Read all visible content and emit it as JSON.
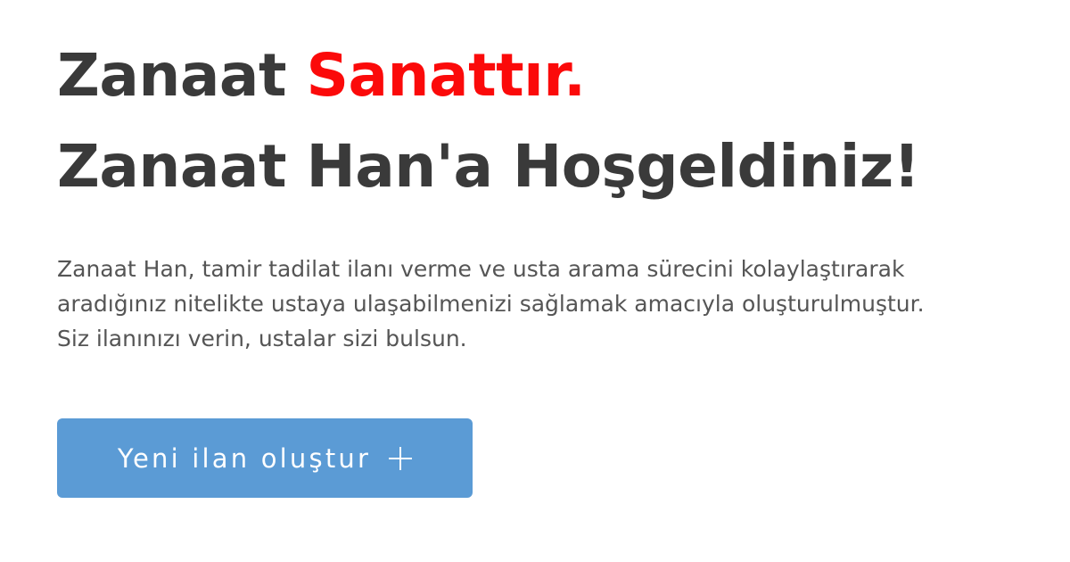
{
  "hero": {
    "headline_line1_part1": "Zanaat ",
    "headline_line1_accent": "Sanattır.",
    "headline_line2": "Zanaat Han'a Hoşgeldiniz!",
    "description": "Zanaat Han, tamir tadilat ilanı verme ve usta arama sürecini kolaylaştırarak aradığınız nitelikte ustaya ulaşabilmenizi sağlamak amacıyla oluşturulmuştur. Siz ilanınızı verin, ustalar sizi bulsun.",
    "cta_label": "Yeni ilan oluştur",
    "cta_icon": "plus-icon"
  },
  "colors": {
    "heading": "#3a3a3a",
    "accent": "#fb0a0a",
    "body_text": "#555555",
    "button_bg": "#5b9bd5",
    "button_text": "#ffffff",
    "background": "#ffffff"
  }
}
